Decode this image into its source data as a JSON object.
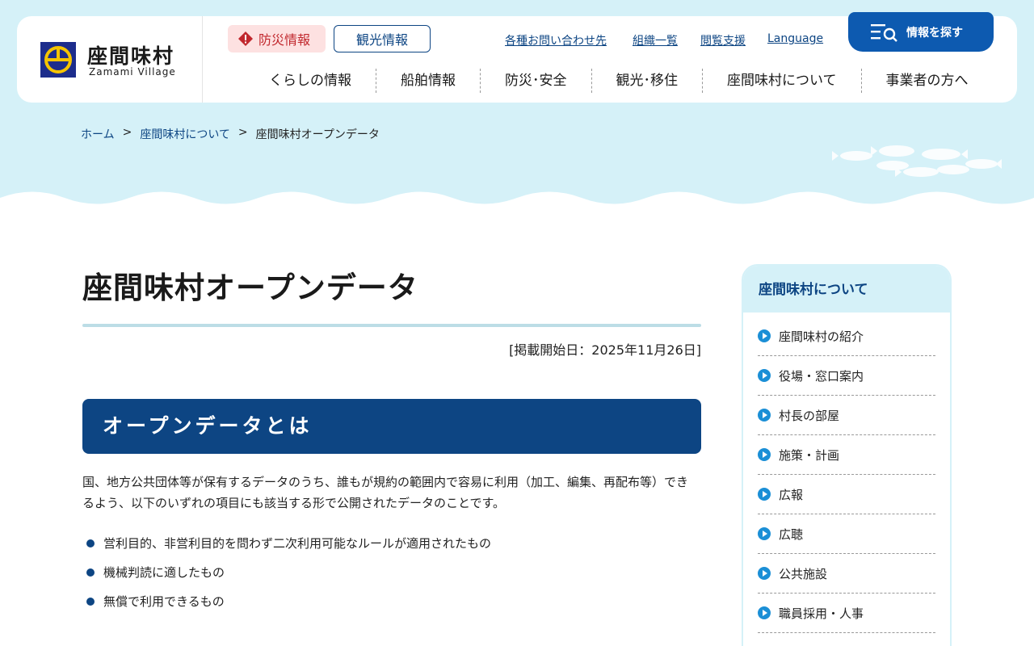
{
  "header": {
    "logo_ja": "座間味村",
    "logo_en": "Zamami Village",
    "bousai_label": "防災情報",
    "kanko_label": "観光情報",
    "util_links": [
      "各種お問い合わせ先",
      "組織一覧",
      "閲覧支援",
      "Language"
    ],
    "search_label": "情報を探す",
    "gnav": [
      "くらしの情報",
      "船舶情報",
      "防災･安全",
      "観光･移住",
      "座間味村について",
      "事業者の方へ"
    ]
  },
  "breadcrumb": {
    "home": "ホーム",
    "sep": ">",
    "parent": "座間味村について",
    "current": "座間味村オープンデータ"
  },
  "main": {
    "title": "座間味村オープンデータ",
    "post_date": "[掲載開始日：2025年11月26日]",
    "h2": "オープンデータとは",
    "paragraph": "国、地方公共団体等が保有するデータのうち、誰もが規約の範囲内で容易に利用（加工、編集、再配布等）できるよう、以下のいずれの項目にも該当する形で公開されたデータのことです。",
    "bullets": [
      "営利目的、非営利目的を問わず二次利用可能なルールが適用されたもの",
      "機械判読に適したもの",
      "無償で利用できるもの"
    ]
  },
  "sidebar": {
    "heading": "座間味村について",
    "items": [
      "座間味村の紹介",
      "役場・窓口案内",
      "村長の部屋",
      "施策・計画",
      "広報",
      "広聴",
      "公共施設",
      "職員採用・人事"
    ]
  },
  "colors": {
    "primary": "#0d4583",
    "sky": "#d5f1f8",
    "accent_blue": "#0d5ab0",
    "bousai_red": "#c1272d"
  }
}
